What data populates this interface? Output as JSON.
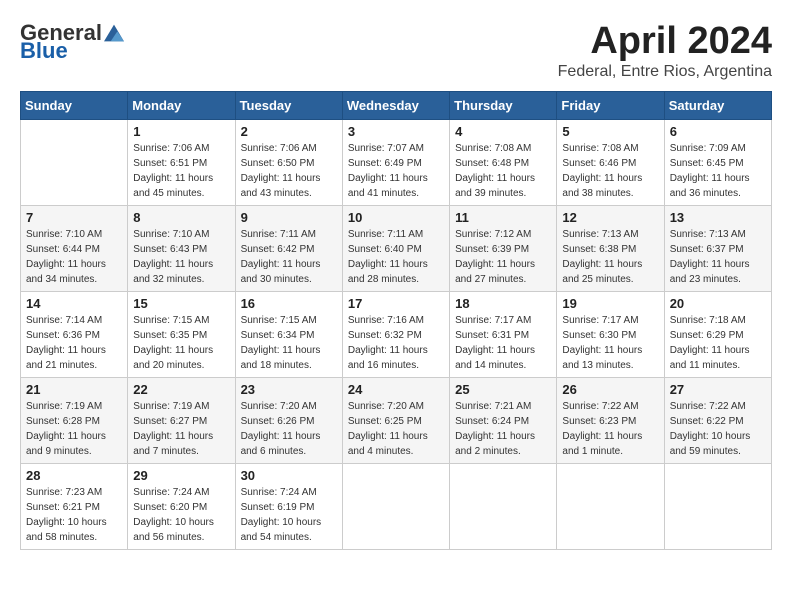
{
  "logo": {
    "general": "General",
    "blue": "Blue"
  },
  "title": "April 2024",
  "subtitle": "Federal, Entre Rios, Argentina",
  "days_of_week": [
    "Sunday",
    "Monday",
    "Tuesday",
    "Wednesday",
    "Thursday",
    "Friday",
    "Saturday"
  ],
  "weeks": [
    [
      {
        "day": "",
        "sunrise": "",
        "sunset": "",
        "daylight": ""
      },
      {
        "day": "1",
        "sunrise": "Sunrise: 7:06 AM",
        "sunset": "Sunset: 6:51 PM",
        "daylight": "Daylight: 11 hours and 45 minutes."
      },
      {
        "day": "2",
        "sunrise": "Sunrise: 7:06 AM",
        "sunset": "Sunset: 6:50 PM",
        "daylight": "Daylight: 11 hours and 43 minutes."
      },
      {
        "day": "3",
        "sunrise": "Sunrise: 7:07 AM",
        "sunset": "Sunset: 6:49 PM",
        "daylight": "Daylight: 11 hours and 41 minutes."
      },
      {
        "day": "4",
        "sunrise": "Sunrise: 7:08 AM",
        "sunset": "Sunset: 6:48 PM",
        "daylight": "Daylight: 11 hours and 39 minutes."
      },
      {
        "day": "5",
        "sunrise": "Sunrise: 7:08 AM",
        "sunset": "Sunset: 6:46 PM",
        "daylight": "Daylight: 11 hours and 38 minutes."
      },
      {
        "day": "6",
        "sunrise": "Sunrise: 7:09 AM",
        "sunset": "Sunset: 6:45 PM",
        "daylight": "Daylight: 11 hours and 36 minutes."
      }
    ],
    [
      {
        "day": "7",
        "sunrise": "Sunrise: 7:10 AM",
        "sunset": "Sunset: 6:44 PM",
        "daylight": "Daylight: 11 hours and 34 minutes."
      },
      {
        "day": "8",
        "sunrise": "Sunrise: 7:10 AM",
        "sunset": "Sunset: 6:43 PM",
        "daylight": "Daylight: 11 hours and 32 minutes."
      },
      {
        "day": "9",
        "sunrise": "Sunrise: 7:11 AM",
        "sunset": "Sunset: 6:42 PM",
        "daylight": "Daylight: 11 hours and 30 minutes."
      },
      {
        "day": "10",
        "sunrise": "Sunrise: 7:11 AM",
        "sunset": "Sunset: 6:40 PM",
        "daylight": "Daylight: 11 hours and 28 minutes."
      },
      {
        "day": "11",
        "sunrise": "Sunrise: 7:12 AM",
        "sunset": "Sunset: 6:39 PM",
        "daylight": "Daylight: 11 hours and 27 minutes."
      },
      {
        "day": "12",
        "sunrise": "Sunrise: 7:13 AM",
        "sunset": "Sunset: 6:38 PM",
        "daylight": "Daylight: 11 hours and 25 minutes."
      },
      {
        "day": "13",
        "sunrise": "Sunrise: 7:13 AM",
        "sunset": "Sunset: 6:37 PM",
        "daylight": "Daylight: 11 hours and 23 minutes."
      }
    ],
    [
      {
        "day": "14",
        "sunrise": "Sunrise: 7:14 AM",
        "sunset": "Sunset: 6:36 PM",
        "daylight": "Daylight: 11 hours and 21 minutes."
      },
      {
        "day": "15",
        "sunrise": "Sunrise: 7:15 AM",
        "sunset": "Sunset: 6:35 PM",
        "daylight": "Daylight: 11 hours and 20 minutes."
      },
      {
        "day": "16",
        "sunrise": "Sunrise: 7:15 AM",
        "sunset": "Sunset: 6:34 PM",
        "daylight": "Daylight: 11 hours and 18 minutes."
      },
      {
        "day": "17",
        "sunrise": "Sunrise: 7:16 AM",
        "sunset": "Sunset: 6:32 PM",
        "daylight": "Daylight: 11 hours and 16 minutes."
      },
      {
        "day": "18",
        "sunrise": "Sunrise: 7:17 AM",
        "sunset": "Sunset: 6:31 PM",
        "daylight": "Daylight: 11 hours and 14 minutes."
      },
      {
        "day": "19",
        "sunrise": "Sunrise: 7:17 AM",
        "sunset": "Sunset: 6:30 PM",
        "daylight": "Daylight: 11 hours and 13 minutes."
      },
      {
        "day": "20",
        "sunrise": "Sunrise: 7:18 AM",
        "sunset": "Sunset: 6:29 PM",
        "daylight": "Daylight: 11 hours and 11 minutes."
      }
    ],
    [
      {
        "day": "21",
        "sunrise": "Sunrise: 7:19 AM",
        "sunset": "Sunset: 6:28 PM",
        "daylight": "Daylight: 11 hours and 9 minutes."
      },
      {
        "day": "22",
        "sunrise": "Sunrise: 7:19 AM",
        "sunset": "Sunset: 6:27 PM",
        "daylight": "Daylight: 11 hours and 7 minutes."
      },
      {
        "day": "23",
        "sunrise": "Sunrise: 7:20 AM",
        "sunset": "Sunset: 6:26 PM",
        "daylight": "Daylight: 11 hours and 6 minutes."
      },
      {
        "day": "24",
        "sunrise": "Sunrise: 7:20 AM",
        "sunset": "Sunset: 6:25 PM",
        "daylight": "Daylight: 11 hours and 4 minutes."
      },
      {
        "day": "25",
        "sunrise": "Sunrise: 7:21 AM",
        "sunset": "Sunset: 6:24 PM",
        "daylight": "Daylight: 11 hours and 2 minutes."
      },
      {
        "day": "26",
        "sunrise": "Sunrise: 7:22 AM",
        "sunset": "Sunset: 6:23 PM",
        "daylight": "Daylight: 11 hours and 1 minute."
      },
      {
        "day": "27",
        "sunrise": "Sunrise: 7:22 AM",
        "sunset": "Sunset: 6:22 PM",
        "daylight": "Daylight: 10 hours and 59 minutes."
      }
    ],
    [
      {
        "day": "28",
        "sunrise": "Sunrise: 7:23 AM",
        "sunset": "Sunset: 6:21 PM",
        "daylight": "Daylight: 10 hours and 58 minutes."
      },
      {
        "day": "29",
        "sunrise": "Sunrise: 7:24 AM",
        "sunset": "Sunset: 6:20 PM",
        "daylight": "Daylight: 10 hours and 56 minutes."
      },
      {
        "day": "30",
        "sunrise": "Sunrise: 7:24 AM",
        "sunset": "Sunset: 6:19 PM",
        "daylight": "Daylight: 10 hours and 54 minutes."
      },
      {
        "day": "",
        "sunrise": "",
        "sunset": "",
        "daylight": ""
      },
      {
        "day": "",
        "sunrise": "",
        "sunset": "",
        "daylight": ""
      },
      {
        "day": "",
        "sunrise": "",
        "sunset": "",
        "daylight": ""
      },
      {
        "day": "",
        "sunrise": "",
        "sunset": "",
        "daylight": ""
      }
    ]
  ]
}
